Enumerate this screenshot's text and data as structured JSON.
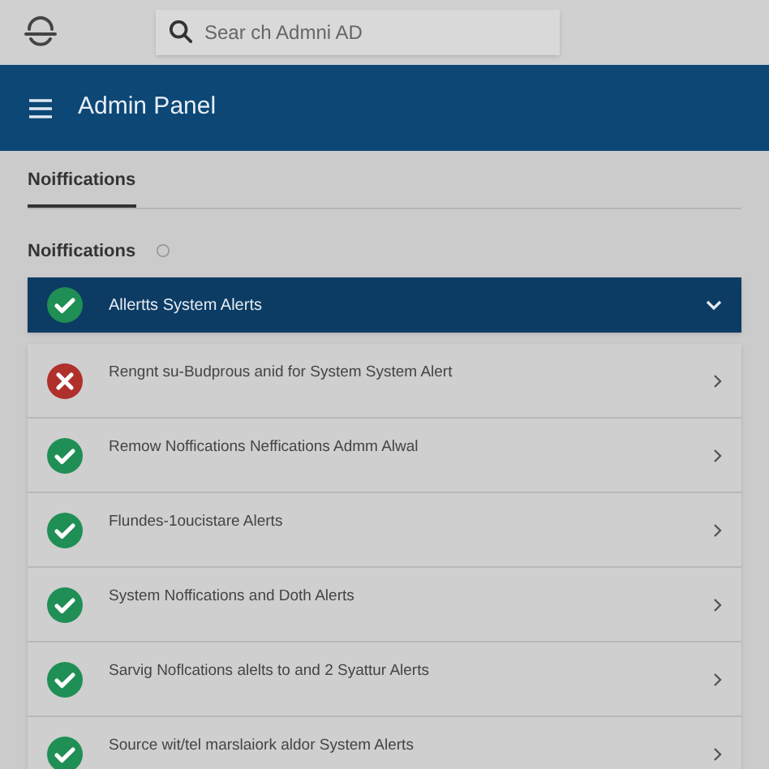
{
  "search": {
    "placeholder": "Sear ch Admni AD"
  },
  "header": {
    "title": "Admin Panel"
  },
  "tabs": [
    {
      "label": "Noiffications",
      "selected": true
    }
  ],
  "section": {
    "title": "Noiffications"
  },
  "accordion": {
    "title": "Allertts System Alerts",
    "kind": "success",
    "expanded": true
  },
  "items": [
    {
      "text": "Rengnt su-Budprous anid for System System Alert",
      "kind": "error"
    },
    {
      "text": "Remow Noffications Neffications Admm Alwal",
      "kind": "success"
    },
    {
      "text": "Flundes-1oucistare Alerts",
      "kind": "success"
    },
    {
      "text": "System Noffications and Doth Alerts",
      "kind": "success"
    },
    {
      "text": "Sarvig Noflcations alelts to and 2 Syattur Alerts",
      "kind": "success"
    },
    {
      "text": "Source wit/tel marslaiork aldor System Alerts",
      "kind": "success"
    }
  ]
}
